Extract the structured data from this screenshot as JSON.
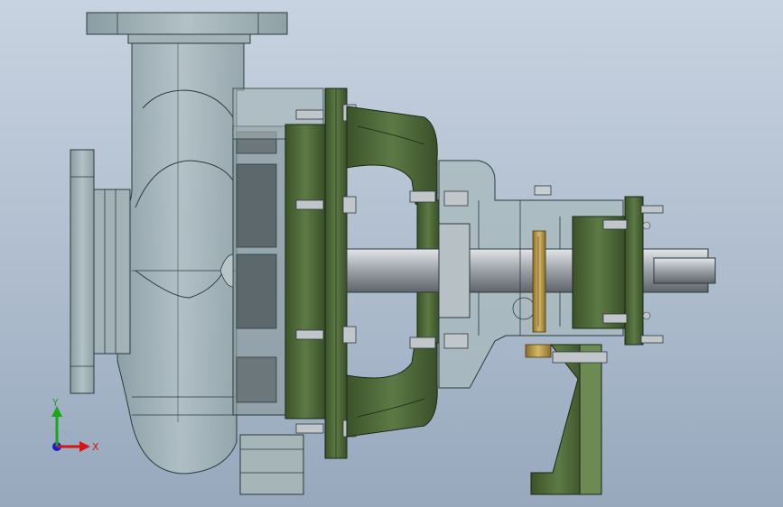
{
  "viewport": {
    "background_top": "#c8d3e1",
    "background_bottom": "#97a8bd"
  },
  "model": {
    "casing_color": "#9fb0b4",
    "green_color": "#4f6a3a",
    "shaft_color": "#c9cdd1",
    "brass_color": "#b59443"
  },
  "triad": {
    "x_label": "X",
    "y_label": "Y",
    "x_color": "#d01818",
    "y_color": "#1aa81a",
    "z_color": "#1a1ad0"
  }
}
